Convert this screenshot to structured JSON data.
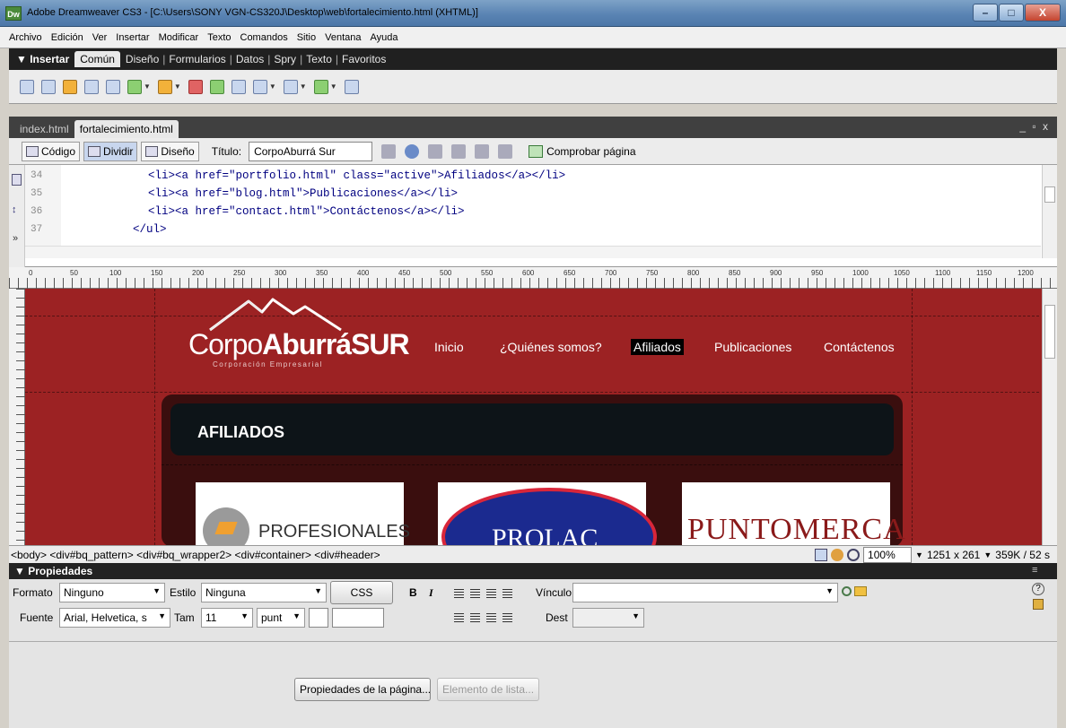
{
  "window": {
    "app_icon": "Dw",
    "title": "Adobe Dreamweaver CS3 - [C:\\Users\\SONY VGN-CS320J\\Desktop\\web\\fortalecimiento.html (XHTML)]",
    "minimize": "–",
    "maximize": "□",
    "close": "X"
  },
  "menu": [
    "Archivo",
    "Edición",
    "Ver",
    "Insertar",
    "Modificar",
    "Texto",
    "Comandos",
    "Sitio",
    "Ventana",
    "Ayuda"
  ],
  "insert_bar": {
    "title": "▼ Insertar",
    "tabs": [
      "Común",
      "Diseño",
      "Formularios",
      "Datos",
      "Spry",
      "Texto",
      "Favoritos"
    ]
  },
  "document": {
    "tabs": [
      "index.html",
      "fortalecimiento.html"
    ],
    "win_controls": "_ ▫ x",
    "view_buttons": [
      "Código",
      "Dividir",
      "Diseño"
    ],
    "title_label": "Título:",
    "title_value": "CorpoAburrá Sur",
    "check_page": "Comprobar página"
  },
  "code": {
    "line_numbers": [
      "34",
      "35",
      "36",
      "37"
    ],
    "lines": [
      "<li><a href=\"portfolio.html\" class=\"active\">Afiliados</a></li>",
      "<li><a href=\"blog.html\">Publicaciones</a></li>",
      "<li><a href=\"contact.html\">Contáctenos</a></li>",
      "</ul>"
    ]
  },
  "ruler_labels": [
    "0",
    "50",
    "100",
    "150",
    "200",
    "250",
    "300",
    "350",
    "400",
    "450",
    "500",
    "550",
    "600",
    "650",
    "700",
    "750",
    "800",
    "850",
    "900",
    "950",
    "1000",
    "1050",
    "1100",
    "1150",
    "1200"
  ],
  "site": {
    "logo_light": "Corpo",
    "logo_bold": "AburráSUR",
    "logo_sub": "Corporación Empresarial",
    "nav": [
      "Inicio",
      "¿Quiénes somos?",
      "Afiliados",
      "Publicaciones",
      "Contáctenos"
    ],
    "active_nav": "Afiliados",
    "section_title": "AFILIADOS",
    "cards": [
      "PROFESIONALES",
      "PROLAC",
      "PUNTOMERCA"
    ]
  },
  "status": {
    "tag_selector": "<body> <div#bq_pattern> <div#bq_wrapper2> <div#container> <div#header>",
    "zoom": "100%",
    "dimensions": "1251 x 261",
    "size_time": "359K / 52 s"
  },
  "properties": {
    "header": "▼ Propiedades",
    "format_label": "Formato",
    "format_value": "Ninguno",
    "style_label": "Estilo",
    "style_value": "Ninguna",
    "css_button": "CSS",
    "bold": "B",
    "italic": "I",
    "link_label": "Vínculo",
    "link_value": "",
    "font_label": "Fuente",
    "font_value": "Arial, Helvetica, s",
    "size_label": "Tam",
    "size_value": "11",
    "unit_value": "punt",
    "dest_label": "Dest",
    "dest_value": "",
    "page_props_button": "Propiedades de la página...",
    "list_item_button": "Elemento de lista..."
  },
  "colors": {
    "site_background": "#9c2223",
    "panel_dark": "#3a0e0e",
    "panel_header": "#0d1418"
  }
}
